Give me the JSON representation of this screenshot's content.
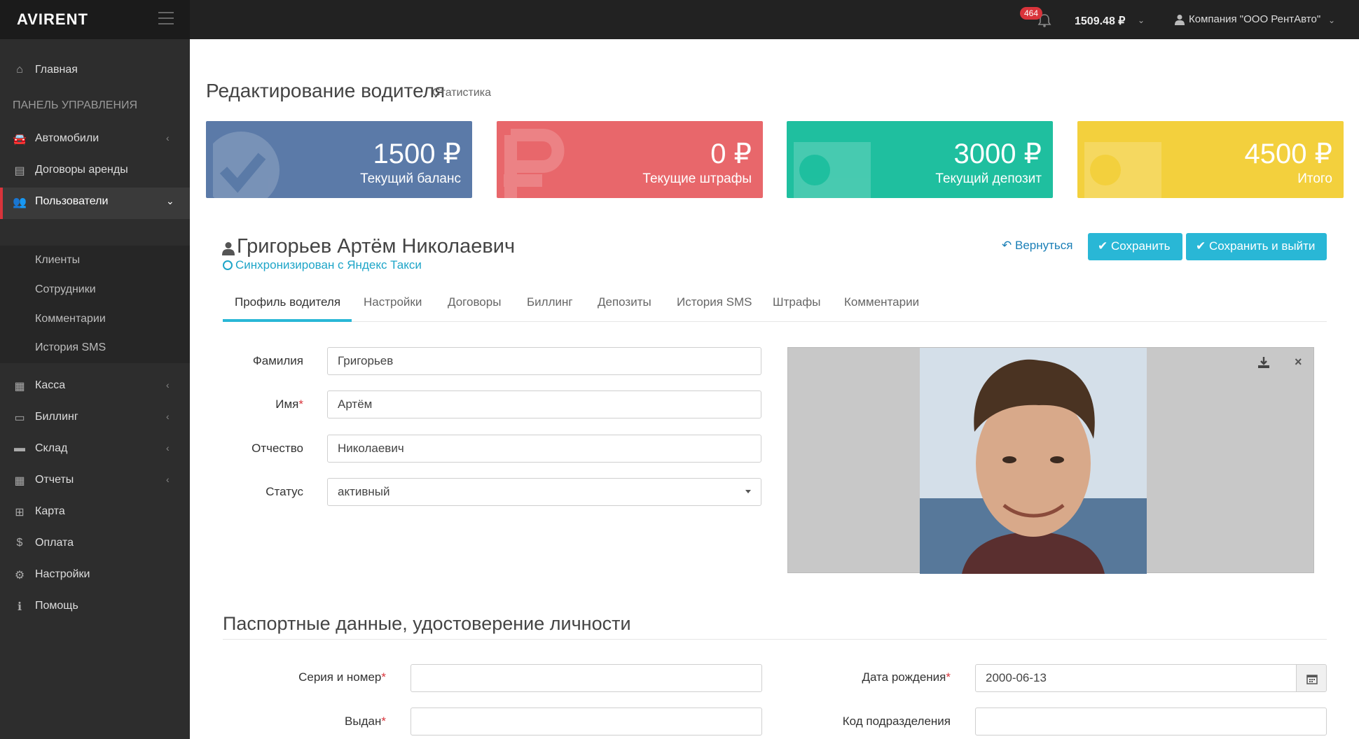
{
  "brand": "AVIRENT",
  "topbar": {
    "notifications_count": "464",
    "balance": "1509.48 ₽",
    "company": "Компания \"ООО РентАвто\""
  },
  "sidebar": {
    "section_label": "ПАНЕЛЬ УПРАВЛЕНИЯ",
    "items": [
      {
        "label": "Главная",
        "icon": "home-icon"
      },
      {
        "label": "Автомобили",
        "icon": "car-icon"
      },
      {
        "label": "Договоры аренды",
        "icon": "document-icon"
      },
      {
        "label": "Пользователи",
        "icon": "users-icon"
      },
      {
        "label": "Касса",
        "icon": "cash-register-icon"
      },
      {
        "label": "Биллинг",
        "icon": "credit-card-icon"
      },
      {
        "label": "Склад",
        "icon": "archive-icon"
      },
      {
        "label": "Отчеты",
        "icon": "table-icon"
      },
      {
        "label": "Карта",
        "icon": "map-icon"
      },
      {
        "label": "Оплата",
        "icon": "dollar-icon"
      },
      {
        "label": "Настройки",
        "icon": "gears-icon"
      },
      {
        "label": "Помощь",
        "icon": "info-icon"
      }
    ],
    "subitems": [
      "Клиенты",
      "Сотрудники",
      "Комментарии",
      "История SMS"
    ]
  },
  "page": {
    "title": "Редактирование водителя",
    "subtitle": "Статистика"
  },
  "stats": [
    {
      "value": "1500 ₽",
      "caption": "Текущий баланс",
      "color": "#5b7aa8"
    },
    {
      "value": "0 ₽",
      "caption": "Текущие штрафы",
      "color": "#e8676b"
    },
    {
      "value": "3000 ₽",
      "caption": "Текущий депозит",
      "color": "#1fbf9f"
    },
    {
      "value": "4500 ₽",
      "caption": "Итого",
      "color": "#f3d03d"
    }
  ],
  "driver": {
    "full_name": "Григорьев Артём Николаевич",
    "sync_status": "Синхронизирован с Яндекс Такси"
  },
  "actions": {
    "back": "Вернуться",
    "save": "Сохранить",
    "save_exit": "Сохранить и выйти"
  },
  "tabs": [
    "Профиль водителя",
    "Настройки",
    "Договоры",
    "Биллинг",
    "Депозиты",
    "История SMS",
    "Штрафы",
    "Комментарии"
  ],
  "form": {
    "last_name_label": "Фамилия",
    "last_name": "Григорьев",
    "first_name_label": "Имя",
    "first_name": "Артём",
    "patronymic_label": "Отчество",
    "patronymic": "Николаевич",
    "status_label": "Статус",
    "status": "активный"
  },
  "passport": {
    "title": "Паспортные данные, удостоверение личности",
    "series_label": "Серия и номер",
    "series": "",
    "issued_label": "Выдан",
    "issued": "",
    "birth_label": "Дата рождения",
    "birth": "2000-06-13",
    "division_label": "Код подразделения",
    "division": ""
  }
}
